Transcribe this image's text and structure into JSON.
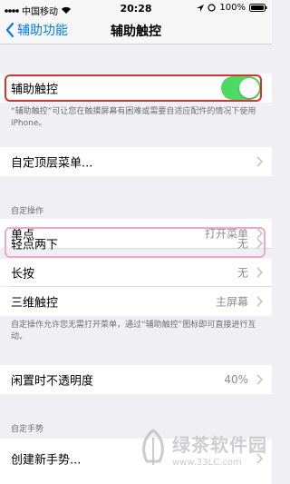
{
  "status": {
    "carrier": "中国移动",
    "time": "20:28",
    "battery": "100%"
  },
  "nav": {
    "back": "辅助功能",
    "title": "辅助触控"
  },
  "toggle_row": {
    "label": "辅助触控",
    "on": true
  },
  "toggle_note": "“辅助触控”可让您在触摸屏幕有困难或需要自适应配件的情况下使用 iPhone。",
  "custom_menu": {
    "label": "自定顶层菜单..."
  },
  "actions_header": "自定操作",
  "actions": [
    {
      "label": "单点",
      "value": "打开菜单"
    },
    {
      "label": "轻点两下",
      "value": "无"
    },
    {
      "label": "长按",
      "value": "无"
    },
    {
      "label": "三维触控",
      "value": "主屏幕"
    }
  ],
  "actions_note": "自定操作允许您无需打开菜单，通过“辅助触控”图标即可直接进行互动。",
  "idle_opacity": {
    "label": "闲置时不透明度",
    "value": "40%"
  },
  "gestures_header": "自定手势",
  "new_gesture": {
    "label": "创建新手势..."
  },
  "watermark": {
    "text": "绿茶软件园",
    "url": "www.33LC.com"
  },
  "colors": {
    "accent": "#007aff",
    "toggle_on": "#4cd964",
    "highlight_red": "#e0302e",
    "highlight_pink": "#f0a8c8"
  }
}
